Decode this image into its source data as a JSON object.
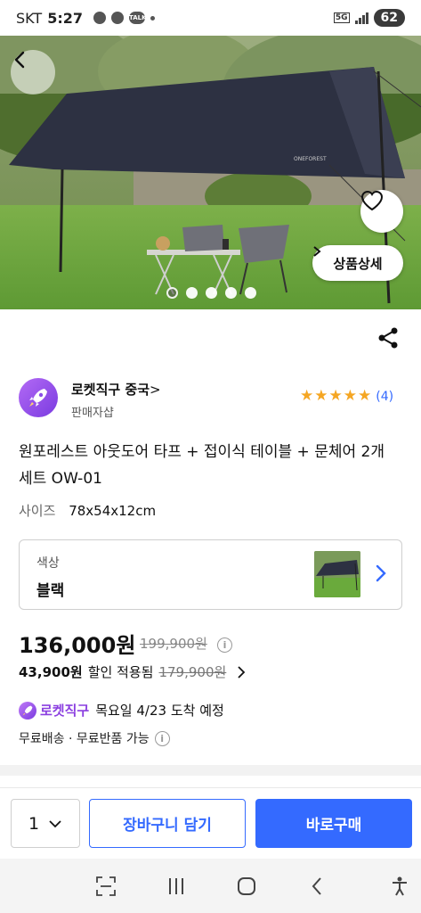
{
  "status_bar": {
    "carrier": "SKT",
    "time": "5:27",
    "network": "5G",
    "talk_badge": "TALK",
    "battery": "62"
  },
  "hero": {
    "tent_brand": "ONEFOREST",
    "detail_button_label": "상품상세",
    "slide_count": 5,
    "active_slide": 1
  },
  "seller": {
    "name": "로켓직구 중국",
    "name_suffix": ">",
    "subtitle": "판매자샵",
    "rating_stars": 5,
    "review_count": "(4)"
  },
  "product": {
    "title": "원포레스트 아웃도어 타프 + 접이식 테이블 + 문체어 2개 세트 OW-01",
    "size_label": "사이즈",
    "size_value": "78x54x12cm",
    "color_label": "색상",
    "color_value": "블랙"
  },
  "price": {
    "main": "136,000원",
    "original": "199,900원",
    "discount_price": "43,900원",
    "discount_text": "할인 적용됨",
    "discount_original": "179,900원"
  },
  "delivery": {
    "rocket_label": "로켓직구",
    "arrival": "목요일 4/23 도착 예정",
    "shipping": "무료배송 · 무료반품 가능"
  },
  "actions": {
    "quantity": "1",
    "cart_label": "장바구니 담기",
    "buy_label": "바로구매"
  },
  "colors": {
    "accent": "#346aff",
    "rocket_purple": "#8b3fe0",
    "star": "#f5a623"
  }
}
